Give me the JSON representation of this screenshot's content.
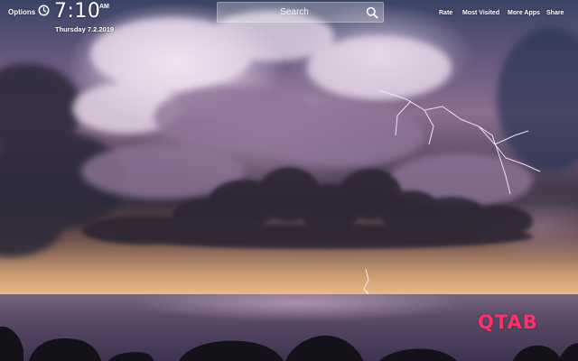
{
  "header": {
    "options_label": "Options",
    "time": "7:10",
    "ampm": "AM",
    "date": "Thursday  7.2.2019"
  },
  "search": {
    "placeholder": "Search"
  },
  "nav": {
    "rate": "Rate",
    "most_visited": "Most Visited",
    "more_apps": "More Apps",
    "share": "Share"
  },
  "brand": {
    "logo_text": "QTAB",
    "color": "#ff2f6e"
  },
  "icons": {
    "clock": "clock-icon",
    "search": "search-icon"
  },
  "background": {
    "description_color_sky": "#6b5a80",
    "description_color_horizon": "#f0c08a"
  }
}
